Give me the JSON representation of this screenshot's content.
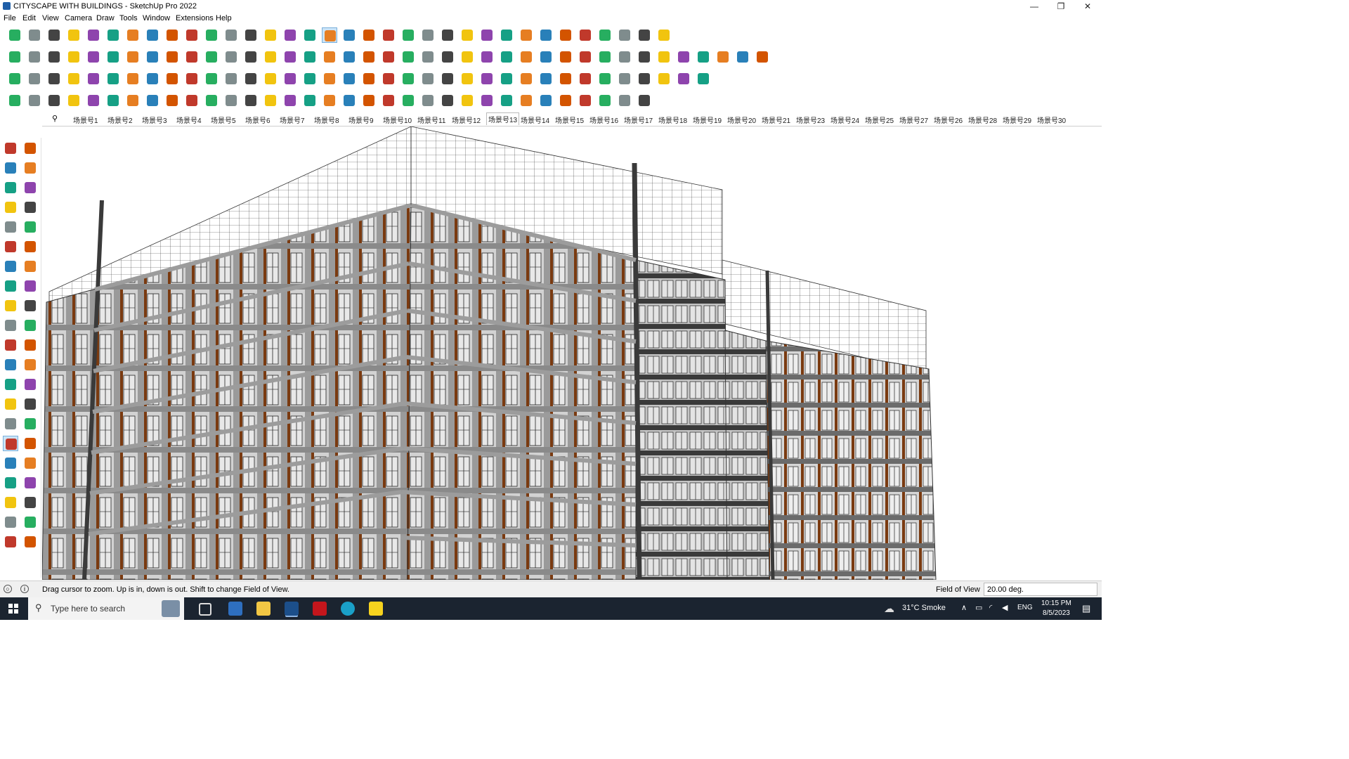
{
  "window": {
    "title": "CITYSCAPE WITH BUILDINGS - SketchUp Pro 2022",
    "minimize_glyph": "—",
    "maximize_glyph": "❐",
    "close_glyph": "✕"
  },
  "menu": [
    "File",
    "Edit",
    "View",
    "Camera",
    "Draw",
    "Tools",
    "Window",
    "Extensions",
    "Help"
  ],
  "scenes": {
    "tabs": [
      "场景号1",
      "场景号2",
      "场景号3",
      "场景号4",
      "场景号5",
      "场景号6",
      "场景号7",
      "场景号8",
      "场景号9",
      "场景号10",
      "场景号11",
      "场景号12",
      "场景号13",
      "场景号14",
      "场景号15",
      "场景号16",
      "场景号17",
      "场景号18",
      "场景号19",
      "场景号20",
      "场景号21",
      "场景号23",
      "场景号24",
      "场景号25",
      "场景号27",
      "场景号26",
      "场景号28",
      "场景号29",
      "场景号30"
    ],
    "active": "场景号13"
  },
  "status": {
    "message": "Drag cursor to zoom.  Up is in, down is out. Shift to change Field of View.",
    "vcb_label": "Field of View",
    "vcb_value": "20.00 deg."
  },
  "taskbar": {
    "search_placeholder": "Type here to search",
    "weather": "31°C  Smoke",
    "language": "ENG",
    "time": "10:15 PM",
    "date": "8/5/2023"
  },
  "colors": {
    "accent_select": "#cce4f7",
    "building_facade": "#cfcfcf",
    "building_panel_wood": "#7a3a10",
    "mullion_dark": "#2f2f2f",
    "taskbar": "#1b2430"
  },
  "toolbars": {
    "row1": [
      "zoom-extents",
      "select",
      "eraser",
      "line",
      "lasso",
      "rectangle",
      "push-pull",
      "follow-me",
      "move",
      "rotate",
      "scale",
      "tape",
      "text",
      "paint",
      "orbit",
      "pan",
      "zoom",
      "zoom-window",
      "zoom-extents-2",
      "section-plane",
      "hidden-geometry",
      "layers",
      "outliner",
      "dimensions",
      "components",
      "camera",
      "walk",
      "look-around",
      "style",
      "shadow",
      "fog",
      "undo",
      "redo",
      "settings"
    ],
    "row2": [
      "iso-view",
      "top-view",
      "front-view",
      "right-view",
      "back-view",
      "left-view",
      "bottom-view",
      "sandbox",
      "from-contours",
      "from-scratch",
      "smoove",
      "stamp",
      "drape",
      "add-detail",
      "flip-edge",
      "house",
      "shed",
      "roof",
      "window-tool",
      "door-tool",
      "stairs",
      "x-ray",
      "wireframe",
      "hidden-line",
      "shaded",
      "textured",
      "monochrome",
      "circle",
      "polygon",
      "arc",
      "ellipse",
      "ruler",
      "paint-bucket",
      "mirror",
      "array",
      "terrain",
      "box",
      "sphere",
      "cone"
    ],
    "row3": [
      "group",
      "explode",
      "hide",
      "unhide",
      "lock",
      "unlock",
      "solid-union",
      "solid-subtract",
      "solid-trim",
      "solid-intersect",
      "outer-shell",
      "split",
      "weld",
      "fillet",
      "chamfer",
      "offset",
      "extrude",
      "loft",
      "sweep",
      "curve",
      "bezier",
      "spline",
      "catmull",
      "nurbs",
      "cut",
      "join",
      "intersect",
      "subdivide",
      "smooth",
      "triangulate",
      "quadrangulate",
      "select-loop",
      "select-ring",
      "grow",
      "shrink",
      "edge-loop"
    ],
    "row4": [
      "edit-vertex",
      "edit-edge",
      "edit-face",
      "bevel",
      "knife",
      "extrude-edge",
      "extrude-face",
      "inset",
      "push-along",
      "pull-along",
      "slide",
      "connect",
      "bridge",
      "fill",
      "cap",
      "collapse",
      "dissolve",
      "merge",
      "flatten",
      "align",
      "distribute",
      "snap",
      "grid",
      "magnet",
      "measure",
      "protractor",
      "axis",
      "guide",
      "section",
      "clip",
      "capture",
      "render",
      "export"
    ],
    "left": [
      "select",
      "orbit",
      "paint",
      "eraser",
      "components",
      "tape",
      "line",
      "freehand",
      "rectangle",
      "rotated-rect",
      "circle",
      "polygon",
      "arc",
      "two-point-arc",
      "pie",
      "three-point-arc",
      "move",
      "push-pull",
      "rotate",
      "follow-me",
      "scale",
      "offset",
      "tape-measure",
      "dimension",
      "protractor",
      "text",
      "axes",
      "3d-text",
      "orbit-2",
      "pan",
      "zoom",
      "zoom-window",
      "zoom-extents",
      "previous",
      "position-camera",
      "look-around",
      "walk",
      "section",
      "hidden",
      "layers",
      "dims",
      "xray"
    ]
  }
}
